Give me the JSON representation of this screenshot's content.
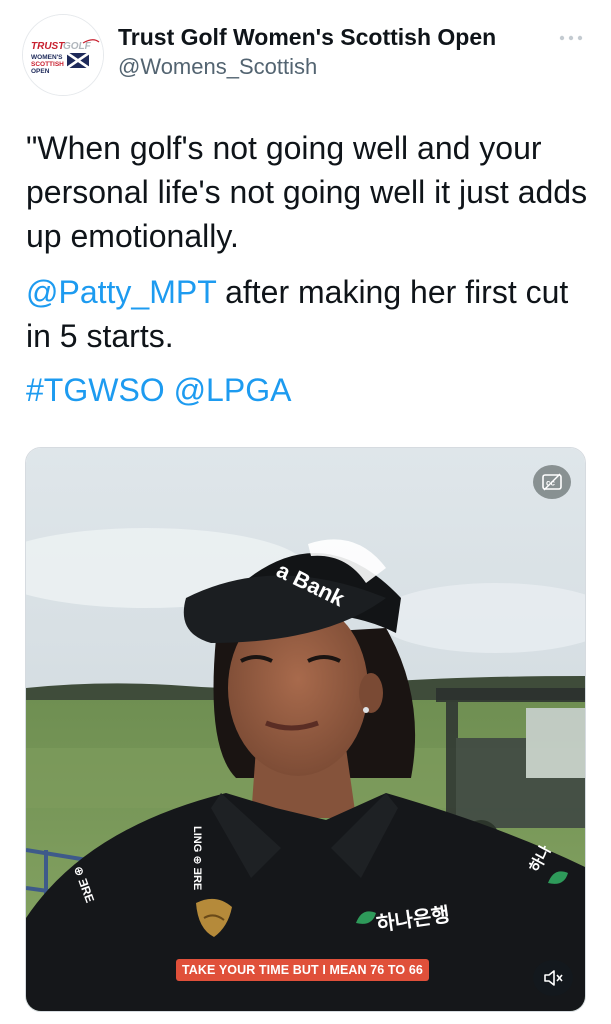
{
  "author": {
    "name": "Trust Golf Women's Scottish Open",
    "handle": "@Womens_Scottish",
    "avatar_logo": {
      "line1": "TRUST",
      "line2": "GOLF",
      "line3": "WOMEN'S",
      "line4": "SCOTTISH",
      "line5": "OPEN"
    }
  },
  "tweet": {
    "quote": "\"When golf's not going well and your personal life's not going well it just adds up emotionally.",
    "mention": "@Patty_MPT",
    "mention_suffix": " after making her first cut in 5 starts.",
    "hashtag": "#TGWSO",
    "mention2": "@LPGA"
  },
  "media": {
    "caption": "TAKE YOUR TIME BUT I MEAN 76 TO 66",
    "visor_text": "a Bank",
    "chest_sponsor": "하나은행",
    "sleeve_sponsor": "하나",
    "collar_text": "LING ⊕ ƎRE",
    "left_sleeve_text": "⊕ ƎRE"
  },
  "icons": {
    "more": "more-horizontal-icon",
    "captions": "closed-captions-icon",
    "mute": "volume-muted-icon"
  },
  "colors": {
    "link": "#1d9bf0",
    "text": "#0f1419",
    "secondary": "#536471",
    "caption_bg": "#e0503a"
  }
}
